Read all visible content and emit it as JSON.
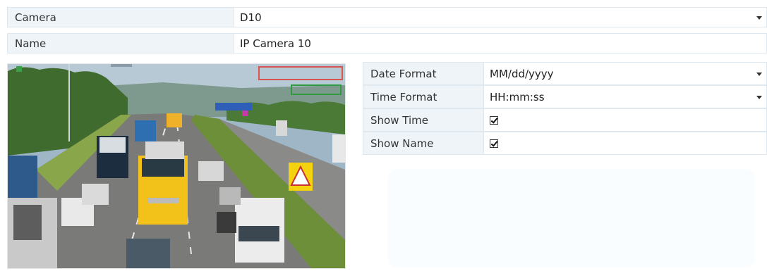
{
  "camera": {
    "label": "Camera",
    "value": "D10"
  },
  "name": {
    "label": "Name",
    "value": "IP Camera 10"
  },
  "osd_settings": {
    "date_format": {
      "label": "Date Format",
      "value": "MM/dd/yyyy"
    },
    "time_format": {
      "label": "Time Format",
      "value": "HH:mm:ss"
    },
    "show_time": {
      "label": "Show Time",
      "checked": true
    },
    "show_name": {
      "label": "Show Name",
      "checked": true
    }
  },
  "preview": {
    "overlay_colors": {
      "time_box": "#d9534f",
      "name_box": "#2e9b3e",
      "blue_box": "#2f5fb8"
    }
  },
  "colors": {
    "label_bg": "#eef4f8",
    "border": "#dfe8ee"
  }
}
